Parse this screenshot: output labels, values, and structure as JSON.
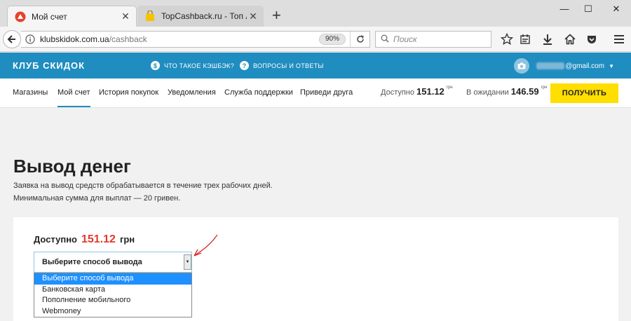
{
  "browser": {
    "tabs": [
      {
        "title": "Мой счет",
        "active": true
      },
      {
        "title": "TopCashback.ru - Топ лучш",
        "active": false
      }
    ],
    "url": {
      "host": "klubskidok.com.ua",
      "path": "/cashback"
    },
    "zoom": "90%",
    "search_placeholder": "Поиск"
  },
  "site": {
    "logo": "КЛУБ СКИДОК",
    "header_links": [
      {
        "icon": "dollar-icon",
        "label": "ЧТО ТАКОЕ КЭШБЭК?"
      },
      {
        "icon": "question-icon",
        "label": "ВОПРОСЫ И ОТВЕТЫ"
      }
    ],
    "user_email_suffix": "@gmail.com",
    "nav": [
      {
        "label": "Магазины",
        "active": false
      },
      {
        "label": "Мой счет",
        "active": true
      },
      {
        "label": "История покупок",
        "active": false
      },
      {
        "label": "Уведомления",
        "active": false
      },
      {
        "label": "Служба поддержки",
        "active": false
      },
      {
        "label": "Приведи друга",
        "active": false
      }
    ],
    "balance": {
      "available_label": "Доступно",
      "available_value": "151.12",
      "pending_label": "В ожидании",
      "pending_value": "146.59",
      "currency_sup": "грн"
    },
    "get_button": "ПОЛУЧИТЬ"
  },
  "content": {
    "title": "Вывод денег",
    "desc_line1": "Заявка на вывод средств обрабатывается в течение трех рабочих дней.",
    "desc_line2": "Минимальная сумма для выплат — 20 гривен.",
    "available_label": "Доступно",
    "available_amount": "151.12",
    "available_currency": "грн",
    "select_value": "Выберите способ вывода",
    "options": [
      "Выберите способ вывода",
      "Банковская карта",
      "Пополнение мобильного",
      "Webmoney"
    ]
  },
  "colors": {
    "brand_blue": "#1f8dc0",
    "accent_yellow": "#ffde00",
    "amount_red": "#e0392d",
    "selection_blue": "#1e90ff"
  }
}
